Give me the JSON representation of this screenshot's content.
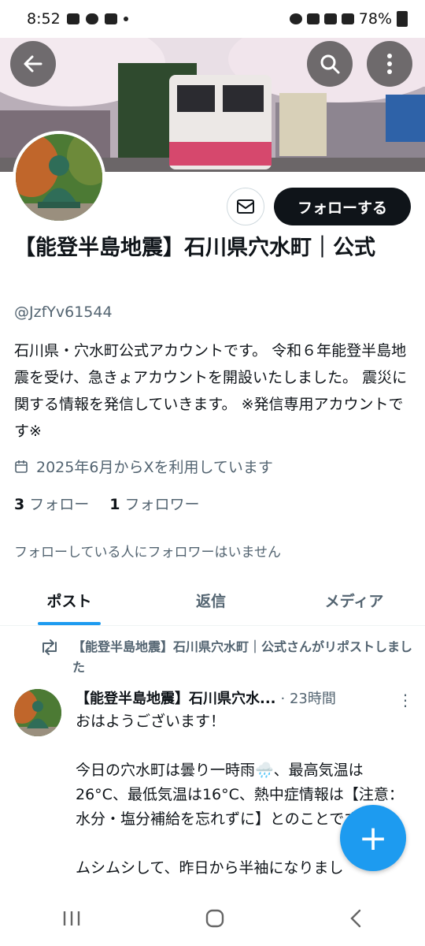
{
  "status_bar": {
    "time": "8:52",
    "battery": "78%"
  },
  "header": {
    "back_icon": "arrow-left-icon",
    "search_icon": "search-icon",
    "more_icon": "more-vertical-icon"
  },
  "profile": {
    "name": "【能登半島地震】石川県穴水町｜公式",
    "handle": "@JzfYv61544",
    "bio": "石川県・穴水町公式アカウントです。 令和６年能登半島地震を受け、急きょアカウントを開設いたしました。 震災に関する情報を発信していきます。 ※発信専用アカウントです※",
    "joined": "2025年6月からXを利用しています",
    "following_count": "3",
    "following_label": "フォロー",
    "followers_count": "1",
    "followers_label": "フォロワー",
    "no_followers_note": "フォローしている人にフォロワーはいません",
    "follow_button": "フォローする"
  },
  "tabs": [
    {
      "label": "ポスト",
      "active": true
    },
    {
      "label": "返信",
      "active": false
    },
    {
      "label": "メディア",
      "active": false
    }
  ],
  "post": {
    "repost_text": "【能登半島地震】石川県穴水町｜公式さんがリポストしました",
    "author": "【能登半島地震】石川県穴水...",
    "time": "· 23時間",
    "body": "おはようございます！\n\n今日の穴水町は曇り一時雨🌧️、最高気温は26°C、最低気温は16°C、熱中症情報は【注意：水分・塩分補給を忘れずに】とのことです。\n\nムシムシして、昨日から半袖になりまし"
  },
  "colors": {
    "accent": "#1d9bf0",
    "text": "#0f1419",
    "muted": "#536471"
  }
}
